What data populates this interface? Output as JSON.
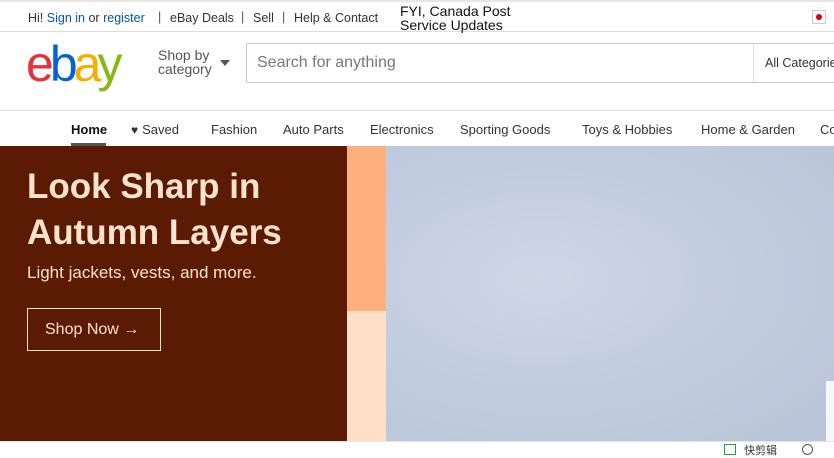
{
  "topbar": {
    "greeting_hi": "Hi!",
    "sign_in": "Sign in",
    "or": "or",
    "register": "register",
    "links": [
      "eBay Deals",
      "Sell",
      "Help & Contact"
    ],
    "separator": "|",
    "fyi_line1": "FYI, Canada Post",
    "fyi_line2": "Service Updates"
  },
  "header": {
    "logo": {
      "e": "e",
      "b": "b",
      "a": "a",
      "y": "y"
    },
    "shop_by_line1": "Shop by",
    "shop_by_line2": "category",
    "search_placeholder": "Search for anything",
    "category_select": "All Categories"
  },
  "nav": {
    "items": [
      "Home",
      "Saved",
      "Fashion",
      "Auto Parts",
      "Electronics",
      "Sporting Goods",
      "Toys & Hobbies",
      "Home & Garden",
      "Co"
    ],
    "active": "Home"
  },
  "hero": {
    "title": "Look Sharp in Autumn Layers",
    "subtitle": "Light jackets, vests, and more.",
    "button_label": "Shop Now",
    "button_arrow": "→"
  },
  "statusbar": {
    "quick_label": "快剪辑"
  },
  "colors": {
    "hero_bg": "#5a1a04",
    "hero_text": "#fde3cc",
    "link": "#0654ba",
    "logo_e": "#e53238",
    "logo_b": "#0064d2",
    "logo_a": "#f5af02",
    "logo_y": "#86b817"
  }
}
